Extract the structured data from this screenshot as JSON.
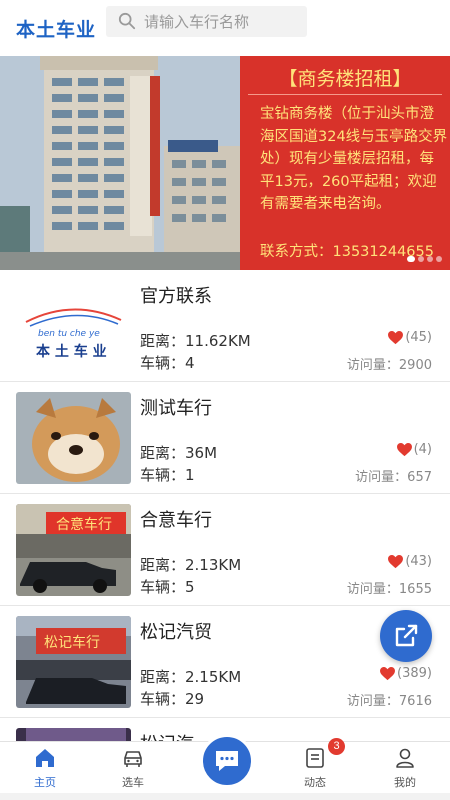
{
  "header": {
    "logo_text": "本土车业",
    "search_placeholder": "请输入车行名称"
  },
  "banner": {
    "ad_title": "【商务楼招租】",
    "ad_body": "宝钻商务楼（位于汕头市澄海区国道324线与玉亭路交界处）现有少量楼层招租，每平13元，260平起租；欢迎有需要者来电咨询。",
    "ad_contact": "联系方式：13531244655",
    "slide_count": 4,
    "active_slide": 1
  },
  "dealers": [
    {
      "name": "官方联系",
      "distance": "距离：11.62KM",
      "cars": "车辆：4",
      "likes": "(45)",
      "visits": "访问量：2900",
      "thumb": "logo"
    },
    {
      "name": "测试车行",
      "distance": "距离：36M",
      "cars": "车辆：1",
      "likes": "(4)",
      "visits": "访问量：657",
      "thumb": "dog"
    },
    {
      "name": "合意车行",
      "distance": "距离：2.13KM",
      "cars": "车辆：5",
      "likes": "(43)",
      "visits": "访问量：1655",
      "thumb": "shop1"
    },
    {
      "name": "松记汽贸",
      "distance": "距离：2.15KM",
      "cars": "车辆：29",
      "likes": "(389)",
      "visits": "访问量：7616",
      "thumb": "shop2"
    },
    {
      "name": "松记汽",
      "distance": "",
      "cars": "",
      "likes": "",
      "visits": "",
      "thumb": "shop3"
    }
  ],
  "tabbar": {
    "home": "主页",
    "select_car": "选车",
    "news": "动态",
    "news_badge": "3",
    "mine": "我的"
  },
  "colors": {
    "brand": "#2f6bcf",
    "ad_background": "#d8322a",
    "ad_text": "#ffe27a",
    "heart": "#e23a2f"
  },
  "icons": [
    "search-icon",
    "heart-icon",
    "share-icon",
    "home-icon",
    "car-icon",
    "chat-icon",
    "news-icon",
    "user-icon"
  ]
}
